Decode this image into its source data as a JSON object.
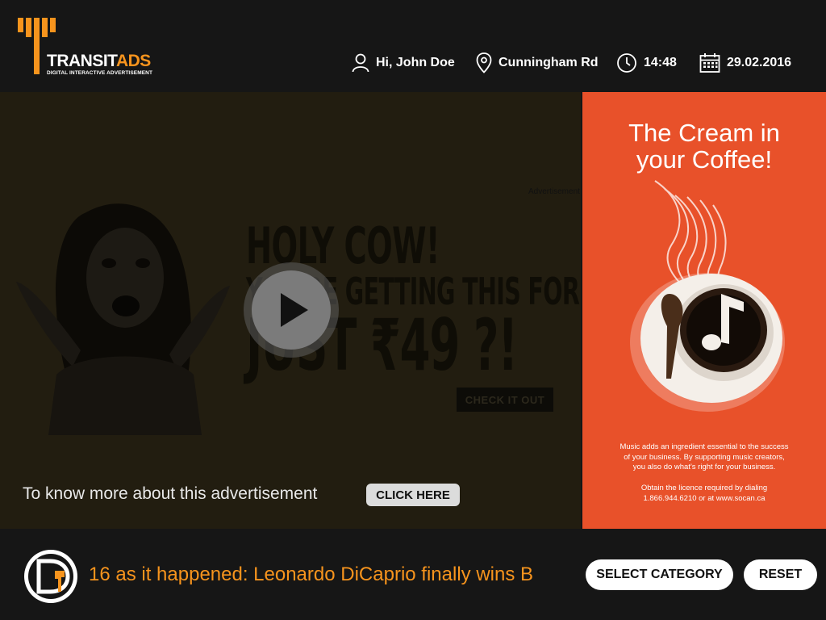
{
  "header": {
    "logo_main": "TRANSIT",
    "logo_accent": "ADS",
    "logo_sub": "DIGITAL INTERACTIVE ADVERTISEMENT",
    "greeting": "Hi, John Doe",
    "location": "Cunningham Rd",
    "time": "14:48",
    "date": "29.02.2016"
  },
  "main_ad": {
    "small_label": "Advertisement",
    "headline_1": "HOLY COW!",
    "headline_2": "YOU'RE GETTING THIS FOR",
    "headline_3": "JUST ₹49 ?!",
    "cta": "CHECK IT OUT",
    "know_more": "To know more about this advertisement",
    "click_here": "CLICK HERE"
  },
  "side_ad": {
    "title_1": "The Cream in",
    "title_2": "your Coffee!",
    "body_1": "Music adds an ingredient essential to the success",
    "body_2": "of your business. By supporting music creators,",
    "body_3": "you also do what's right for your business.",
    "body_4": "Obtain the licence required by dialing",
    "body_5": "1.866.944.6210 or at www.socan.ca"
  },
  "footer": {
    "ticker": "16 as it happened: Leonardo DiCaprio finally wins B",
    "select_category": "SELECT CATEGORY",
    "reset": "RESET"
  },
  "colors": {
    "accent": "#f7941d",
    "side_ad_bg": "#e8512a",
    "bar_bg": "#161616"
  }
}
